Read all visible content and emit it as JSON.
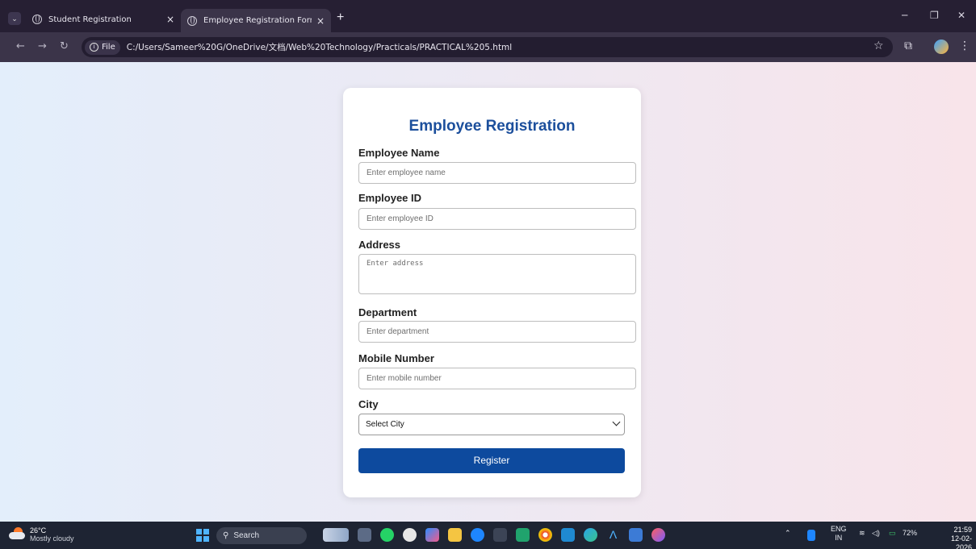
{
  "browser": {
    "tabs": [
      {
        "title": "Student Registration"
      },
      {
        "title": "Employee Registration Form"
      }
    ],
    "chip_label": "File",
    "url": "C:/Users/Sameer%20G/OneDrive/文档/Web%20Technology/Practicals/PRACTICAL%205.html"
  },
  "form": {
    "heading": "Employee Registration",
    "fields": [
      {
        "label": "Employee Name",
        "placeholder": "Enter employee name"
      },
      {
        "label": "Employee ID",
        "placeholder": "Enter employee ID"
      },
      {
        "label": "Address",
        "placeholder": "Enter address"
      },
      {
        "label": "Department",
        "placeholder": "Enter department"
      },
      {
        "label": "Mobile Number",
        "placeholder": "Enter mobile number"
      }
    ],
    "city": {
      "label": "City",
      "selected": "Select City"
    },
    "submit_label": "Register"
  },
  "taskbar": {
    "weather": {
      "temp": "26°C",
      "desc": "Mostly cloudy"
    },
    "search_label": "Search",
    "lang": {
      "top": "ENG",
      "bottom": "IN"
    },
    "battery": "72%",
    "time": "21:59",
    "date": "12-02-2026"
  },
  "colors": {
    "accent": "#0d4a9e",
    "heading": "#1c4f9c",
    "browser_frame": "#261f33"
  }
}
